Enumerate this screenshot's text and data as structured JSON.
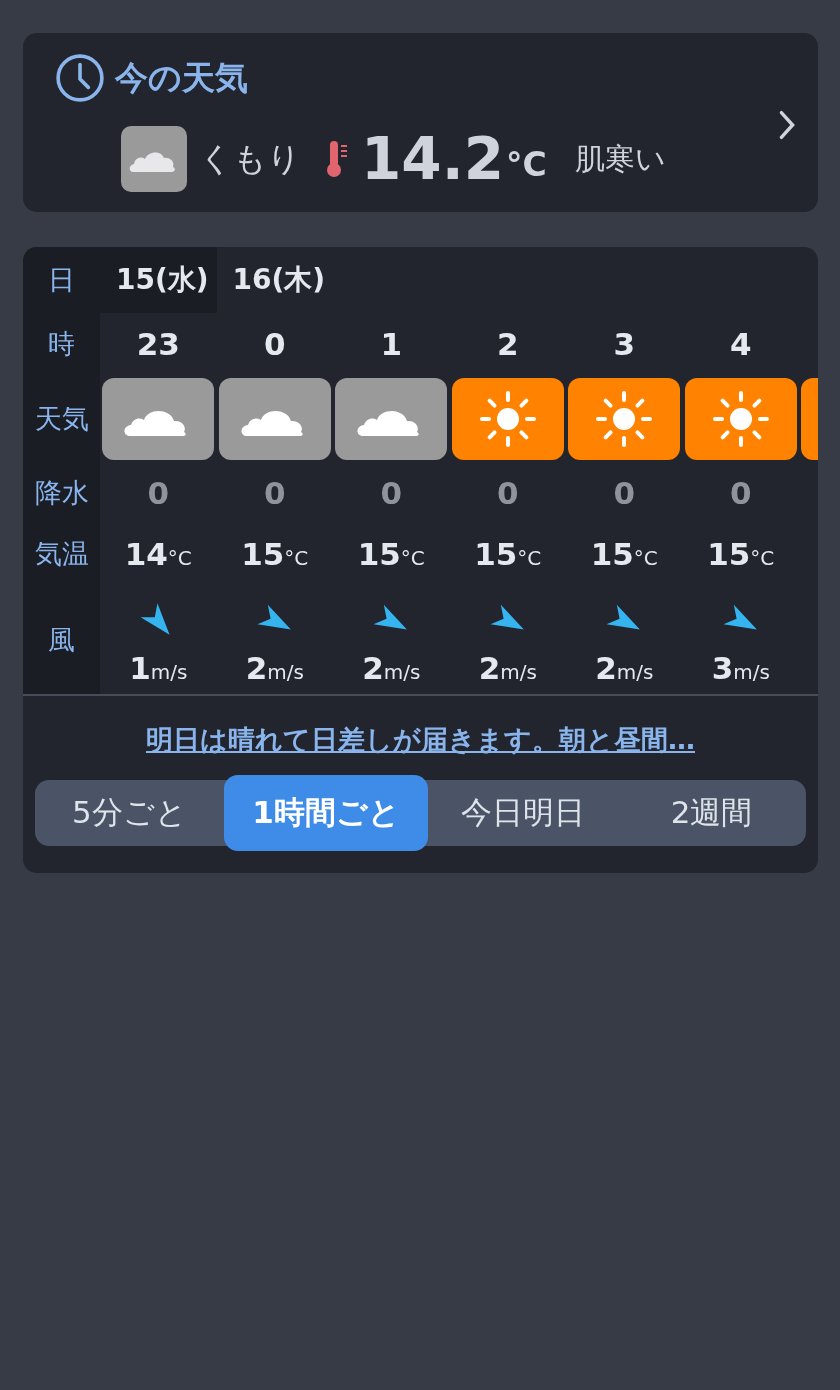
{
  "current": {
    "title": "今の天気",
    "kind": "cloudy",
    "condition": "くもり",
    "temperature": "14.2",
    "unit": "°C",
    "feeling": "肌寒い"
  },
  "forecast": {
    "row_labels": [
      "日",
      "時",
      "天気",
      "降水",
      "気温",
      "風"
    ],
    "days": [
      {
        "label": "15(水)",
        "hours": [
          {
            "kind": "cloudy",
            "hour": "23",
            "precipitation": "0",
            "temperature": "14",
            "temp_unit": "°C",
            "wind": {
              "kind": "nw",
              "speed": "1",
              "unit": "m/s"
            }
          }
        ]
      },
      {
        "label": "16(木)",
        "hours": [
          {
            "kind": "cloudy",
            "hour": "0",
            "precipitation": "0",
            "temperature": "15",
            "temp_unit": "°C",
            "wind": {
              "kind": "wnw",
              "speed": "2",
              "unit": "m/s"
            }
          },
          {
            "kind": "cloudy",
            "hour": "1",
            "precipitation": "0",
            "temperature": "15",
            "temp_unit": "°C",
            "wind": {
              "kind": "wnw",
              "speed": "2",
              "unit": "m/s"
            }
          },
          {
            "kind": "sunny",
            "hour": "2",
            "precipitation": "0",
            "temperature": "15",
            "temp_unit": "°C",
            "wind": {
              "kind": "wnw",
              "speed": "2",
              "unit": "m/s"
            }
          },
          {
            "kind": "sunny",
            "hour": "3",
            "precipitation": "0",
            "temperature": "15",
            "temp_unit": "°C",
            "wind": {
              "kind": "wnw",
              "speed": "2",
              "unit": "m/s"
            }
          },
          {
            "kind": "sunny",
            "hour": "4",
            "precipitation": "0",
            "temperature": "15",
            "temp_unit": "°C",
            "wind": {
              "kind": "wnw",
              "speed": "3",
              "unit": "m/s"
            }
          },
          {
            "kind": "sunny"
          }
        ]
      }
    ]
  },
  "summary_link": "明日は晴れて日差しが届きます。朝と昼間…",
  "tabs": [
    {
      "label": "5分ごと",
      "selected": false
    },
    {
      "label": "1時間ごと",
      "selected": true
    },
    {
      "label": "今日明日",
      "selected": false
    },
    {
      "label": "2週間",
      "selected": false
    }
  ]
}
